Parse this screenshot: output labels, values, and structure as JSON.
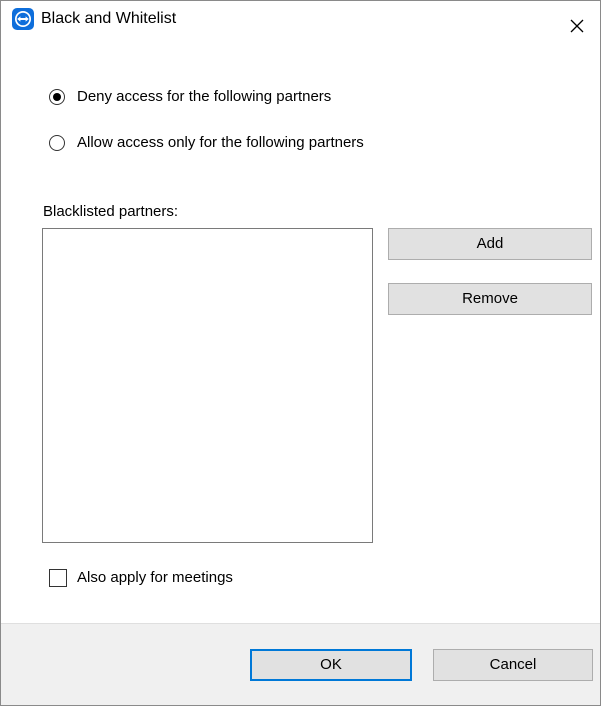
{
  "window": {
    "title": "Black and Whitelist",
    "icon": "teamviewer-app-icon",
    "close_icon": "close-icon",
    "accent_color": "#0e6edb"
  },
  "access_mode": {
    "options": [
      {
        "label": "Deny access for the following partners",
        "selected": true
      },
      {
        "label": "Allow access only for the following partners",
        "selected": false
      }
    ]
  },
  "partners": {
    "list_label": "Blacklisted partners:",
    "items": [],
    "add_label": "Add",
    "remove_label": "Remove"
  },
  "meetings": {
    "checkbox_label": "Also apply for meetings",
    "checked": false
  },
  "footer": {
    "ok_label": "OK",
    "cancel_label": "Cancel",
    "focus_color": "#0078d7"
  }
}
